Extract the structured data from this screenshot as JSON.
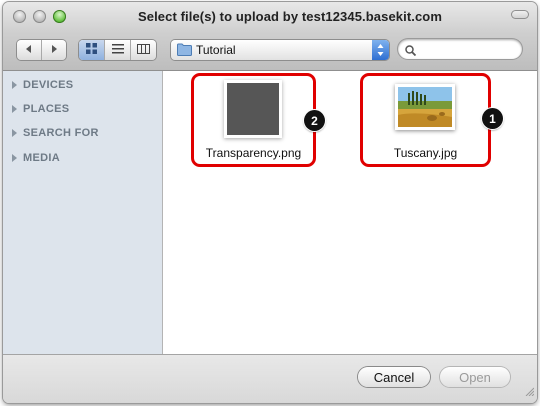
{
  "window": {
    "title": "Select file(s) to upload by test12345.basekit.com"
  },
  "toolbar": {
    "location": "Tutorial",
    "search_value": ""
  },
  "sidebar": {
    "sections": [
      {
        "label": "DEVICES"
      },
      {
        "label": "PLACES"
      },
      {
        "label": "SEARCH FOR"
      },
      {
        "label": "MEDIA"
      }
    ]
  },
  "files": [
    {
      "name": "Transparency.png",
      "callout": "2"
    },
    {
      "name": "Tuscany.jpg",
      "callout": "1"
    }
  ],
  "footer": {
    "cancel_label": "Cancel",
    "open_label": "Open"
  },
  "colors": {
    "highlight": "#e00000",
    "sidebar_bg": "#dde4ec",
    "active_view": "#8fb1df"
  }
}
